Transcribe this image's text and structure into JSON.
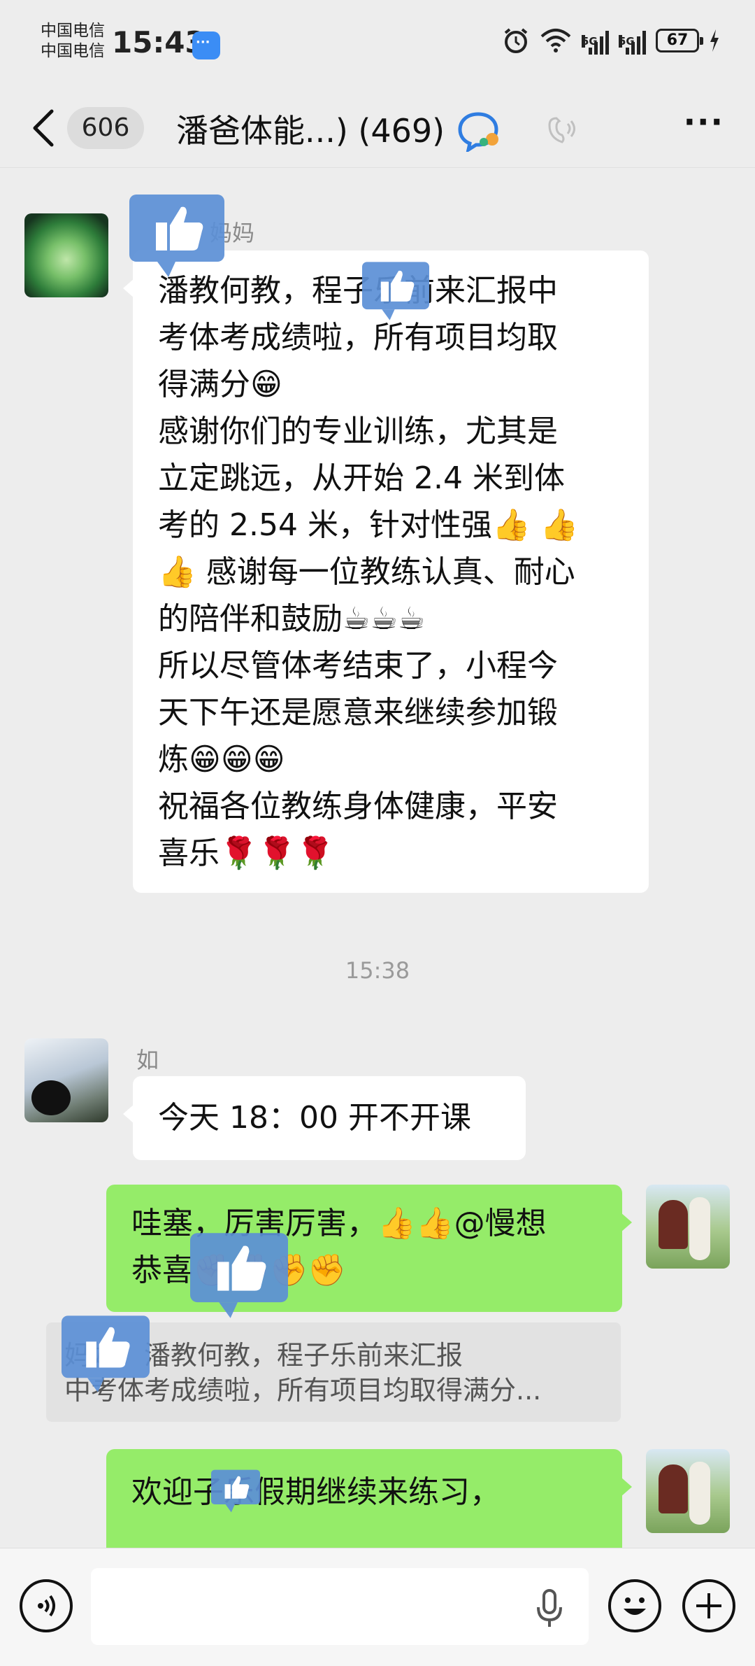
{
  "status_bar": {
    "carrier_1": "中国电信",
    "carrier_2": "中国电信",
    "time": "15:43",
    "network_1": "5G",
    "network_2": "5G",
    "battery": "67"
  },
  "header": {
    "unread_count": "606",
    "title": "潘爸体能...) (469)"
  },
  "messages": [
    {
      "sender": "妈妈",
      "text": "潘教何教，程子乐前来汇报中\n考体考成绩啦，所有项目均取\n得满分😁\n感谢你们的专业训练，尤其是\n立定跳远，从开始 2.4 米到体\n考的 2.54 米，针对性强👍 👍\n👍 感谢每一位教练认真、耐心\n的陪伴和鼓励☕☕☕\n所以尽管体考结束了，小程今\n天下午还是愿意来继续参加锻\n炼😁😁😁\n祝福各位教练身体健康，平安\n喜乐🌹🌹🌹"
    },
    {
      "timestamp": "15:38"
    },
    {
      "sender": "如",
      "text": "今天 18：00 开不开课"
    },
    {
      "text": "哇塞，厉害厉害，👍👍@慢想\n恭喜✊✊✊✊",
      "quote": "妈妈：潘教何教，程子乐前来汇报\n中考体考成绩啦，所有项目均取得满分..."
    },
    {
      "text": "欢迎子乐假期继续来练习，"
    }
  ],
  "colors": {
    "chat_bg": "#ededed",
    "incoming_bubble": "#ffffff",
    "outgoing_bubble": "#95ec69",
    "thumb_overlay": "#5b8fd6"
  },
  "icons": {
    "back": "chevron-left-icon",
    "title_badge": "chat-badge-icon",
    "voice": "earpiece-mode-icon",
    "more": "more-icon",
    "voice_input": "voice-input-icon",
    "mic": "mic-icon",
    "emoji": "emoji-icon",
    "plus": "plus-icon",
    "thumb_overlay": "thumbs-up-icon"
  }
}
